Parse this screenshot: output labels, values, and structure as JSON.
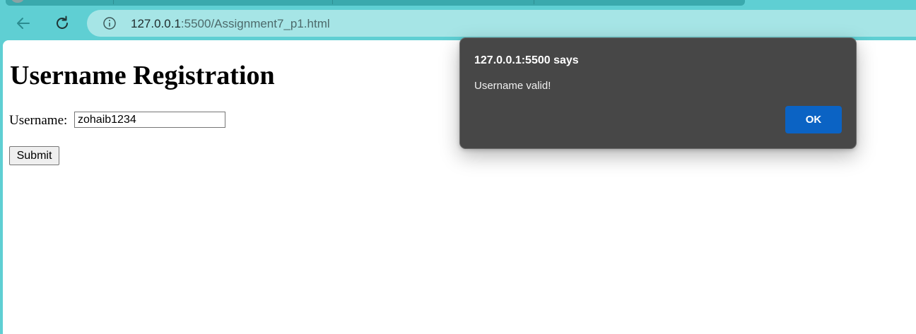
{
  "browser": {
    "url_host": "127.0.0.1",
    "url_path": ":5500/Assignment7_p1.html"
  },
  "page": {
    "title": "Username Registration",
    "username_label": "Username:",
    "username_value": "zohaib1234",
    "submit_label": "Submit"
  },
  "dialog": {
    "title": "127.0.0.1:5500 says",
    "message": "Username valid!",
    "ok_label": "OK"
  },
  "colors": {
    "browser_chrome": "#5fcfd3",
    "omnibox": "#a6e5e6",
    "dialog_bg": "#474747",
    "ok_button": "#0b63c4"
  },
  "icons": {
    "back": "back-arrow-icon",
    "reload": "reload-icon",
    "site_info": "info-icon"
  }
}
